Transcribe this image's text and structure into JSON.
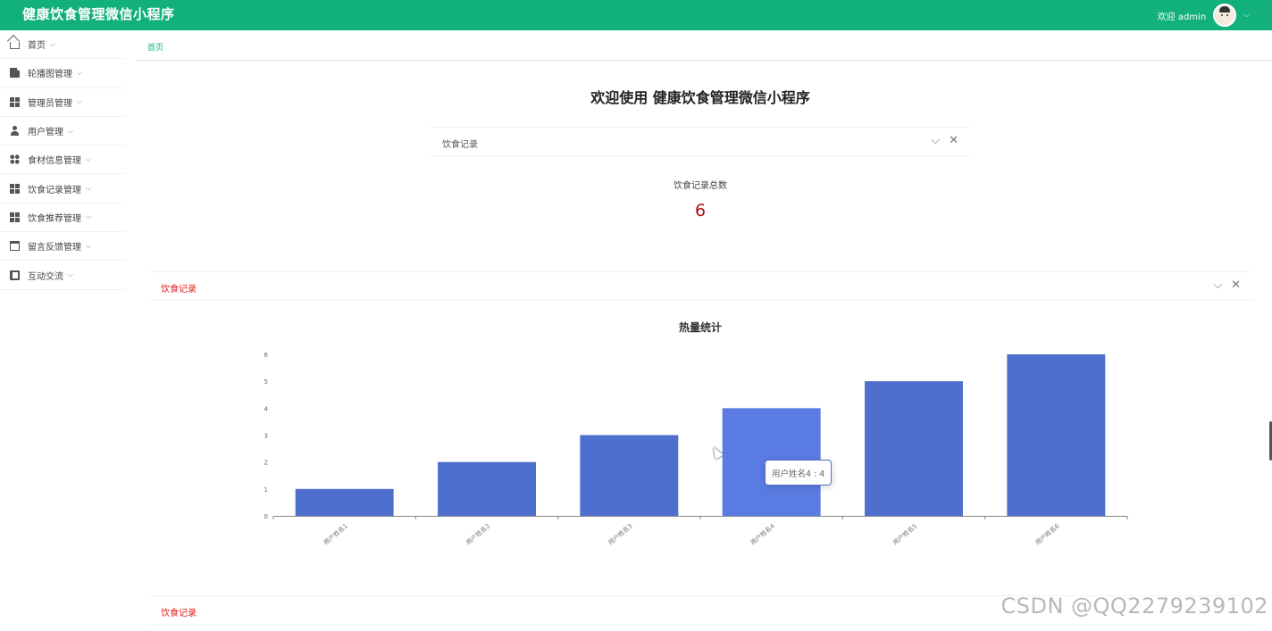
{
  "header": {
    "app_title": "健康饮食管理微信小程序",
    "welcome_user": "欢迎 admin",
    "user_chevron": "⌵"
  },
  "sidebar": {
    "items": [
      {
        "label": "首页",
        "icon": "home-icon"
      },
      {
        "label": "轮播图管理",
        "icon": "image-icon"
      },
      {
        "label": "管理员管理",
        "icon": "grid-icon"
      },
      {
        "label": "用户管理",
        "icon": "user-icon"
      },
      {
        "label": "食材信息管理",
        "icon": "dots-icon"
      },
      {
        "label": "饮食记录管理",
        "icon": "grid-icon"
      },
      {
        "label": "饮食推荐管理",
        "icon": "grid-icon"
      },
      {
        "label": "留言反馈管理",
        "icon": "table-icon"
      },
      {
        "label": "互动交流",
        "icon": "book-icon"
      }
    ],
    "chevron": "⌵"
  },
  "breadcrumb": "首页",
  "main": {
    "welcome_title": "欢迎使用 健康饮食管理微信小程序",
    "stat_card": {
      "title": "饮食记录",
      "stat_label": "饮食记录总数",
      "stat_value": "6"
    },
    "chart_card": {
      "title": "饮食记录",
      "title_color": "#e0201c"
    },
    "bottom_card": {
      "title": "饮食记录",
      "title_color": "#e0201c"
    },
    "tools": {
      "collapse": "⌵",
      "close": "✕"
    },
    "tooltip": "用户姓名4 : 4"
  },
  "chart_data": {
    "type": "bar",
    "title": "热量统计",
    "categories": [
      "用户姓名1",
      "用户姓名2",
      "用户姓名3",
      "用户姓名4",
      "用户姓名5",
      "用户姓名6"
    ],
    "values": [
      1,
      2,
      3,
      4,
      5,
      6
    ],
    "ylim": [
      0,
      6
    ],
    "yticks": [
      0,
      1,
      2,
      3,
      4,
      5,
      6
    ],
    "grid": false,
    "bar_color": "#4f6fcf",
    "highlight_color": "#5a7be2",
    "highlight_index": 3
  },
  "watermark": "CSDN @QQ2279239102",
  "colors": {
    "header_bg": "#12b07c",
    "accent": "#12b07c",
    "stat_value": "#aa1111"
  }
}
